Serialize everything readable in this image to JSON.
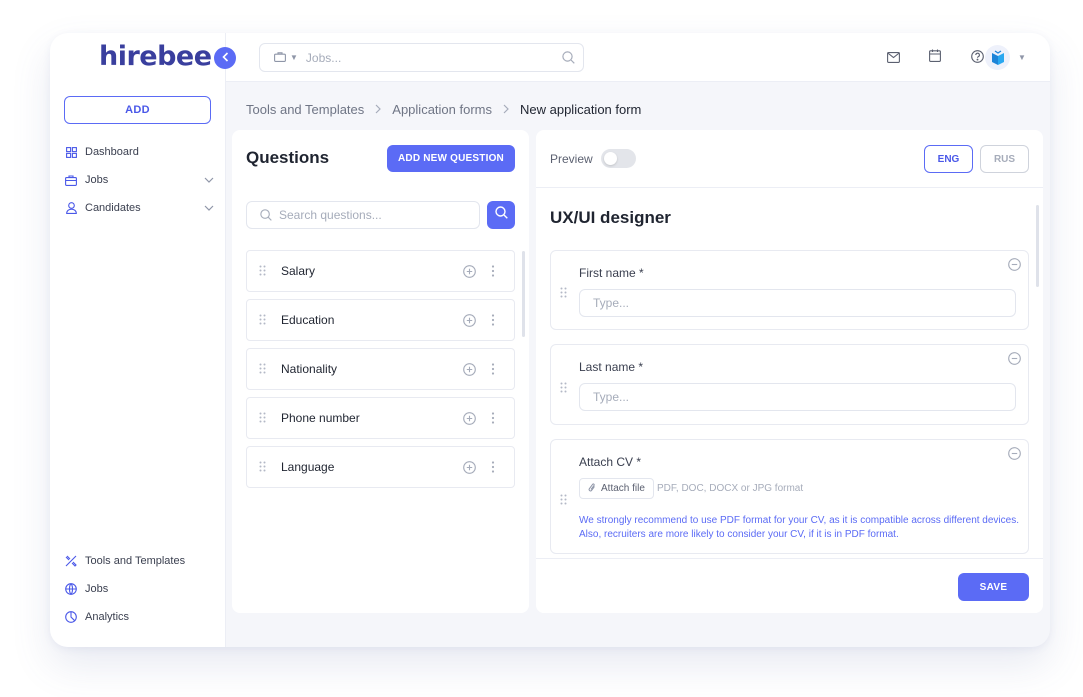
{
  "brand": {
    "logo_text": "hirebee"
  },
  "sidebar": {
    "add_label": "ADD",
    "items": [
      {
        "label": "Dashboard",
        "icon": "dashboard-icon"
      },
      {
        "label": "Jobs",
        "icon": "briefcase-icon"
      },
      {
        "label": "Candidates",
        "icon": "user-icon"
      }
    ],
    "bottom_items": [
      {
        "label": "Tools and Templates",
        "icon": "tools-icon"
      },
      {
        "label": "Jobs",
        "icon": "globe-icon"
      },
      {
        "label": "Analytics",
        "icon": "analytics-icon"
      }
    ]
  },
  "topbar": {
    "search_placeholder": "Jobs..."
  },
  "breadcrumb": {
    "items": [
      "Tools and Templates",
      "Application forms"
    ],
    "current": "New application form"
  },
  "questions": {
    "title": "Questions",
    "add_button": "ADD NEW QUESTION",
    "search_placeholder": "Search questions...",
    "items": [
      "Salary",
      "Education",
      "Nationality",
      "Phone number",
      "Language"
    ]
  },
  "form": {
    "preview_label": "Preview",
    "preview_enabled": false,
    "languages": [
      "ENG",
      "RUS"
    ],
    "active_language": "ENG",
    "title": "UX/UI designer",
    "fields": [
      {
        "label": "First name *",
        "placeholder": "Type..."
      },
      {
        "label": "Last name *",
        "placeholder": "Type..."
      }
    ],
    "attach": {
      "label": "Attach CV *",
      "button": "Attach file",
      "hint": "PDF, DOC, DOCX or JPG format",
      "note": "We strongly recommend to use PDF format  for your CV, as it is compatible across different devices. Also, recruiters are more likely to consider your CV, if it is in PDF format."
    },
    "save_label": "SAVE"
  },
  "colors": {
    "accent": "#5b6bf5",
    "brand_text": "#3a3f9e",
    "background": "#f5f6fa"
  }
}
